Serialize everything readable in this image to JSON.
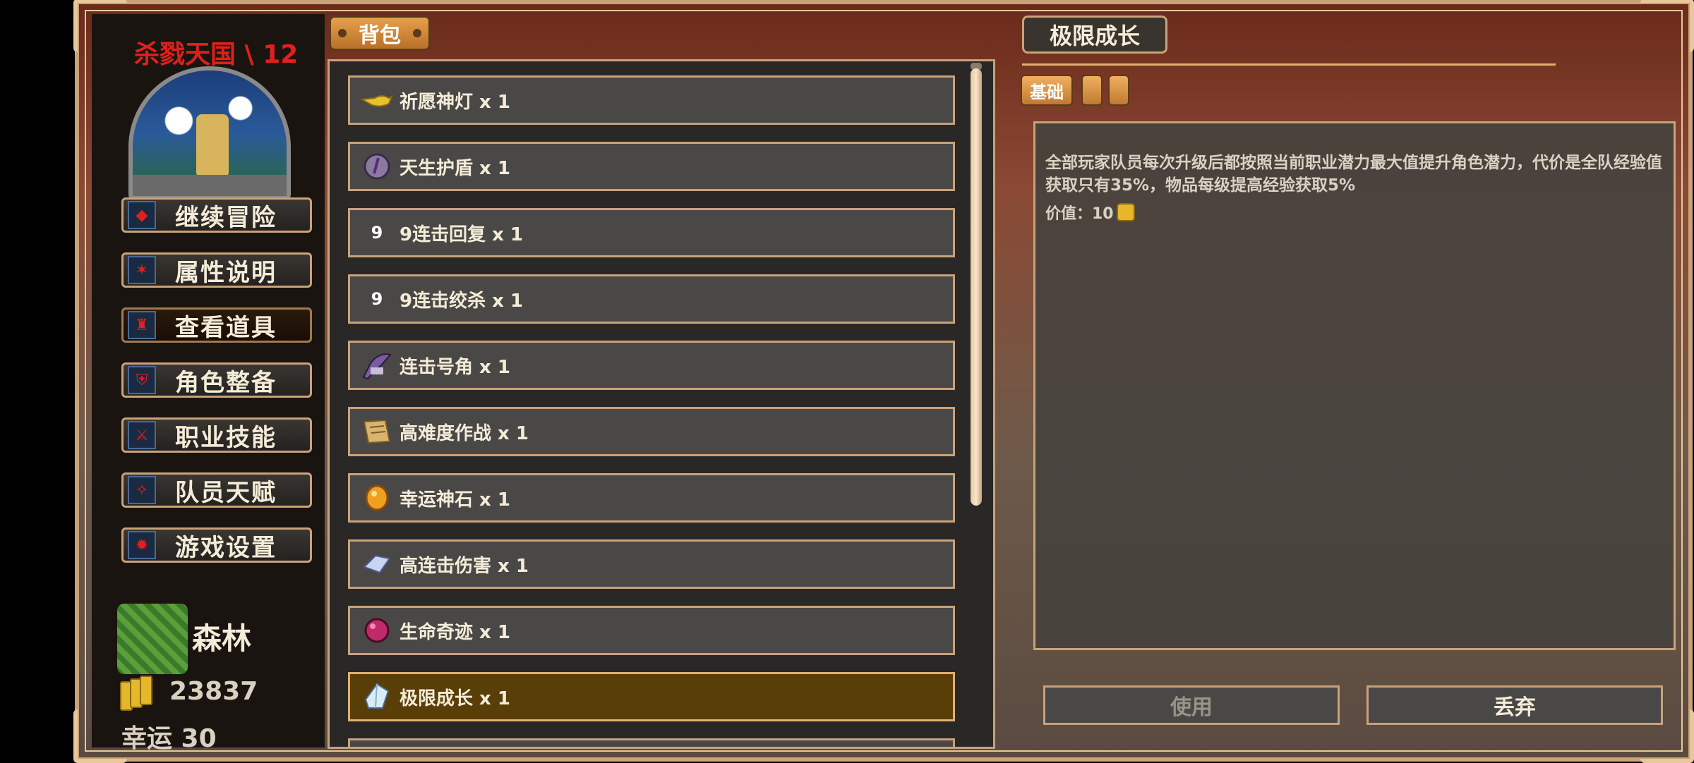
{
  "sidebar": {
    "title": "杀戮天国 \\ 12",
    "menu": [
      {
        "label": "继续冒险",
        "icon": "adventure-icon"
      },
      {
        "label": "属性说明",
        "icon": "attributes-icon"
      },
      {
        "label": "查看道具",
        "icon": "items-icon"
      },
      {
        "label": "角色整备",
        "icon": "equipment-icon"
      },
      {
        "label": "职业技能",
        "icon": "skills-icon"
      },
      {
        "label": "队员天赋",
        "icon": "talent-icon"
      },
      {
        "label": "游戏设置",
        "icon": "settings-icon"
      }
    ],
    "terrain": "森林",
    "gold": "23837",
    "luck": "幸运 30"
  },
  "bag": {
    "tab_label": "背包",
    "items": [
      {
        "name": "祈愿神灯 x 1",
        "icon": "lamp-icon"
      },
      {
        "name": "天生护盾 x 1",
        "icon": "shield-icon"
      },
      {
        "name": "9连击回复 x 1",
        "icon": "nine-icon",
        "glyph": "9"
      },
      {
        "name": "9连击绞杀 x 1",
        "icon": "nine-icon",
        "glyph": "9"
      },
      {
        "name": "连击号角 x 1",
        "icon": "horn-icon"
      },
      {
        "name": "高难度作战 x 1",
        "icon": "scroll-icon"
      },
      {
        "name": "幸运神石 x 1",
        "icon": "lucky-stone-icon"
      },
      {
        "name": "高连击伤害 x 1",
        "icon": "crystal-icon"
      },
      {
        "name": "生命奇迹 x 1",
        "icon": "life-orb-icon"
      },
      {
        "name": "极限成长 x 1",
        "icon": "growth-gem-icon"
      }
    ]
  },
  "detail": {
    "title": "极限成长",
    "tab_basic": "基础",
    "description": "全部玩家队员每次升级后都按照当前职业潜力最大值提升角色潜力，代价是全队经验值获取只有35%，物品每级提高经验获取5%",
    "value_label": "价值：10",
    "use_label": "使用",
    "discard_label": "丢弃"
  }
}
